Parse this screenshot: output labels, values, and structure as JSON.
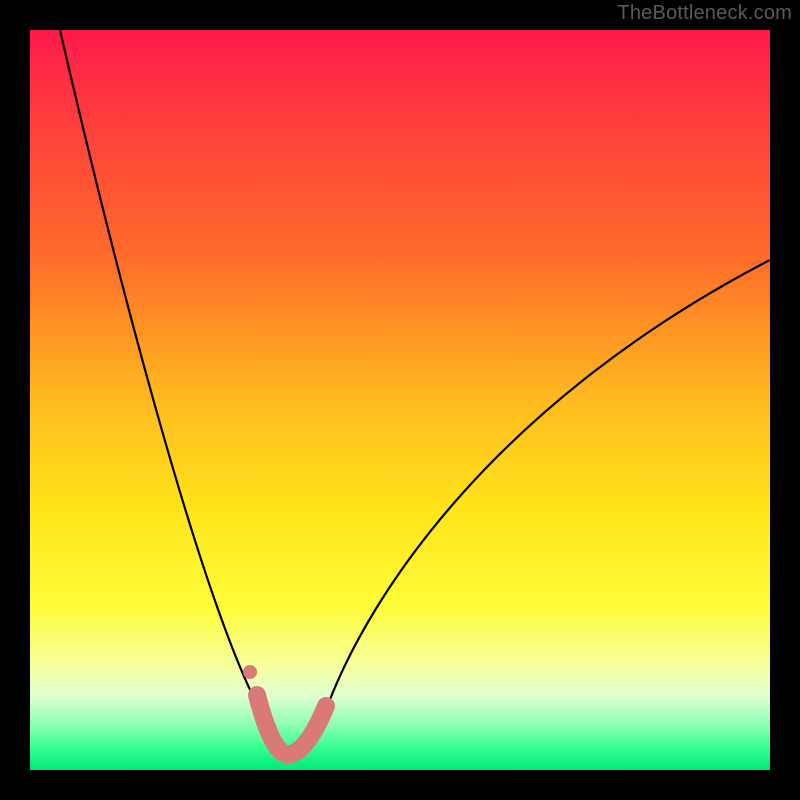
{
  "watermark": "TheBottleneck.com",
  "chart_data": {
    "type": "line",
    "title": "",
    "xlabel": "",
    "ylabel": "",
    "xlim": [
      0,
      100
    ],
    "ylim": [
      0,
      100
    ],
    "series": [
      {
        "name": "bottleneck-curve",
        "x": [
          4,
          6,
          8,
          10,
          12,
          14,
          16,
          18,
          20,
          22,
          24,
          26,
          28,
          30,
          31,
          32,
          33,
          34,
          35,
          36,
          37,
          38,
          40,
          44,
          50,
          56,
          62,
          68,
          74,
          80,
          86,
          92,
          98
        ],
        "values": [
          100,
          92,
          84,
          76,
          68,
          60,
          53,
          46,
          39,
          33,
          27,
          21,
          16,
          10,
          7,
          5,
          3,
          2,
          2,
          2,
          3,
          5,
          9,
          16,
          26,
          34,
          41,
          47,
          53,
          58,
          62,
          66,
          69
        ]
      },
      {
        "name": "highlight-band",
        "x": [
          30,
          31,
          32,
          33,
          34,
          35,
          36,
          37,
          38,
          39
        ],
        "values": [
          10,
          7,
          5,
          3,
          2,
          2,
          2,
          3,
          5,
          7
        ]
      },
      {
        "name": "highlight-dot",
        "x": [
          29.5
        ],
        "values": [
          13
        ]
      }
    ],
    "colors": {
      "curve": "#000000",
      "highlight": "#d97a78",
      "gradient_top": "#ff1a4b",
      "gradient_bottom": "#00e879"
    }
  }
}
